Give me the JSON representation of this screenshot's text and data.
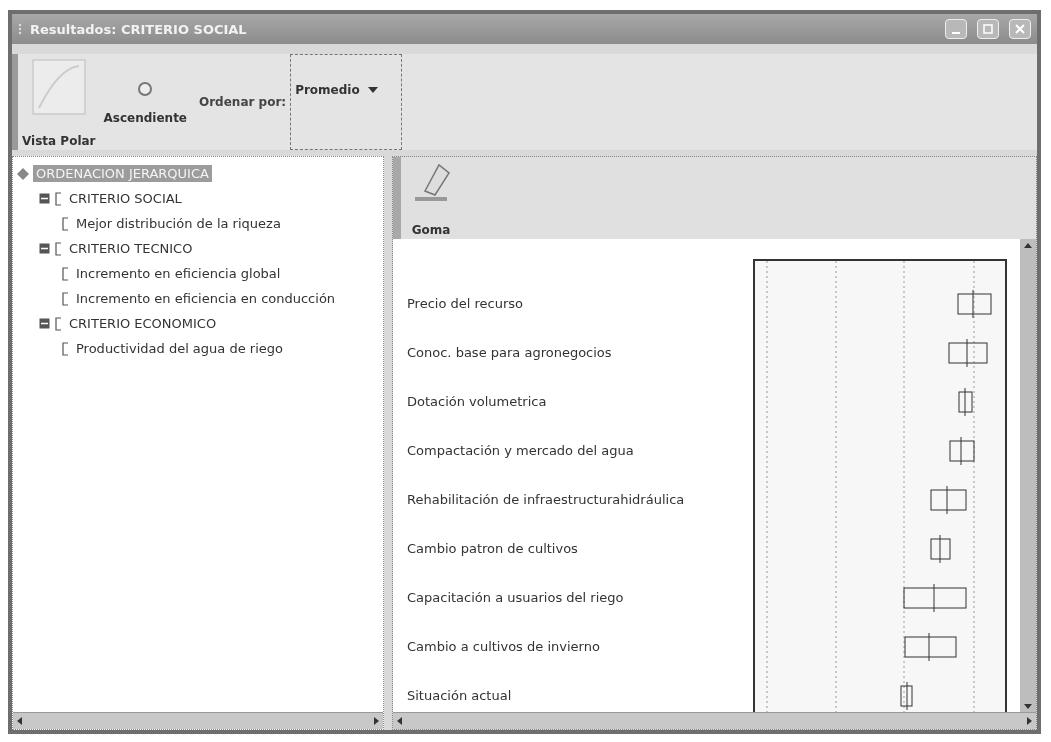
{
  "window": {
    "title": "Resultados: CRITERIO SOCIAL"
  },
  "toolbar": {
    "buttons": [
      {
        "kind": "polar",
        "label": "Vista Polar"
      },
      {
        "kind": "order",
        "label": "Ascendiente"
      }
    ],
    "sort_label": "Ordenar por:",
    "sort_value": "Promedio"
  },
  "tree": {
    "label": "ORDENACION JERARQUICA",
    "selected": true,
    "children": [
      {
        "label": "CRITERIO SOCIAL",
        "selected": false,
        "expanded": true,
        "children": [
          {
            "label": "Mejor distribución de la riqueza",
            "selected": false
          }
        ]
      },
      {
        "label": "CRITERIO TECNICO",
        "selected": false,
        "expanded": true,
        "children": [
          {
            "label": "Incremento en eficiencia global",
            "selected": false
          },
          {
            "label": "Incremento en eficiencia en conducción",
            "selected": false
          }
        ]
      },
      {
        "label": "CRITERIO ECONOMICO",
        "selected": false,
        "expanded": true,
        "children": [
          {
            "label": "Productividad del agua de riego",
            "selected": false
          }
        ]
      }
    ]
  },
  "chart_toolbar": {
    "button": "Goma"
  },
  "alternatives": [
    {
      "label": "Precio del recurso"
    },
    {
      "label": "Conoc. base para agronegocios"
    },
    {
      "label": "Dotación volumetrica"
    },
    {
      "label": "Compactación y mercado del agua"
    },
    {
      "label": "Rehabilitación de infraestructurahidráulica"
    },
    {
      "label": "Cambio patron de cultivos"
    },
    {
      "label": "Capacitación a usuarios del riego"
    },
    {
      "label": "Cambio a cultivos de invierno"
    },
    {
      "label": "Situación actual"
    }
  ]
}
